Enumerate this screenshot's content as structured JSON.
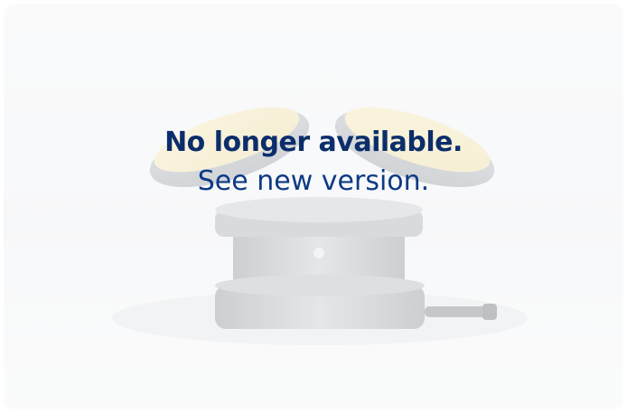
{
  "notice": {
    "headline": "No longer available.",
    "subline": "See new version.",
    "text_color": "#0b2e6b"
  },
  "image": {
    "subject": "lamp-product-photo",
    "tint": "washed-out"
  }
}
